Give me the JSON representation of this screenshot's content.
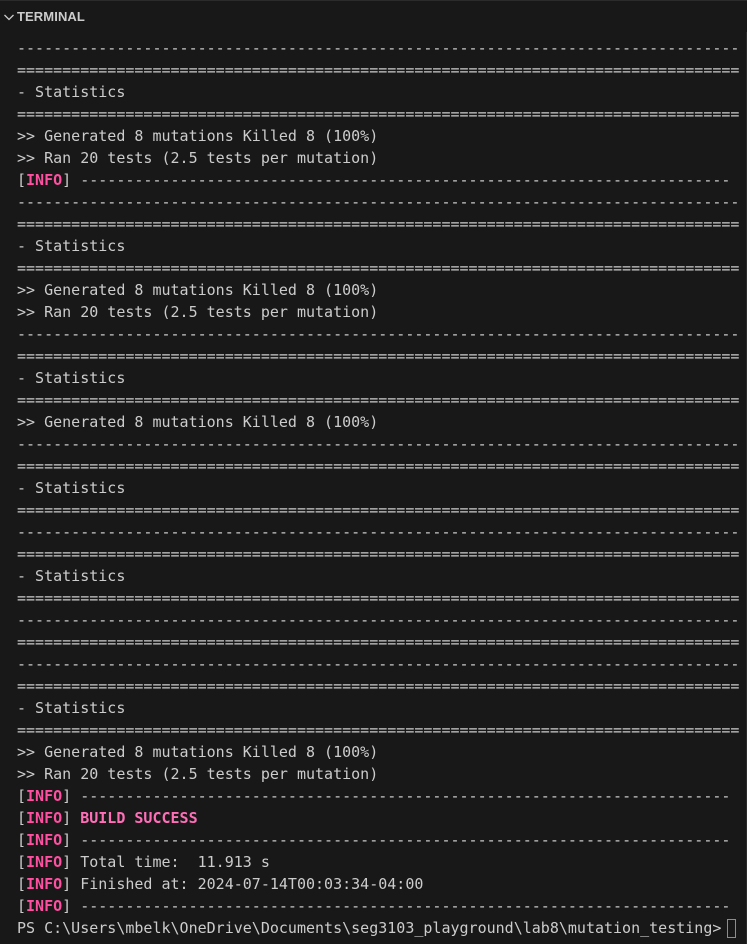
{
  "panel": {
    "title": "TERMINAL",
    "chevron_icon": "chevron-down-icon"
  },
  "colors": {
    "background": "#181818",
    "text": "#cccccc",
    "info": "#ff4fa0",
    "success": "#ff6fb8"
  },
  "terminal": {
    "dash_line": "-----------------------------------------------------------------------------------",
    "equals_line": "===================================================================================",
    "info_dash": "------------------------------------------------------------------------",
    "lines": [
      {
        "kind": "dash"
      },
      {
        "kind": "equals"
      },
      {
        "kind": "text",
        "text": "- Statistics"
      },
      {
        "kind": "equals"
      },
      {
        "kind": "text",
        "text": ">> Generated 8 mutations Killed 8 (100%)"
      },
      {
        "kind": "text",
        "text": ">> Ran 20 tests (2.5 tests per mutation)"
      },
      {
        "kind": "info",
        "text": "------------------------------------------------------------------------"
      },
      {
        "kind": "dash"
      },
      {
        "kind": "equals"
      },
      {
        "kind": "text",
        "text": "- Statistics"
      },
      {
        "kind": "equals"
      },
      {
        "kind": "text",
        "text": ">> Generated 8 mutations Killed 8 (100%)"
      },
      {
        "kind": "text",
        "text": ">> Ran 20 tests (2.5 tests per mutation)"
      },
      {
        "kind": "dash"
      },
      {
        "kind": "equals"
      },
      {
        "kind": "text",
        "text": "- Statistics"
      },
      {
        "kind": "equals"
      },
      {
        "kind": "text",
        "text": ">> Generated 8 mutations Killed 8 (100%)"
      },
      {
        "kind": "dash"
      },
      {
        "kind": "equals"
      },
      {
        "kind": "text",
        "text": "- Statistics"
      },
      {
        "kind": "equals"
      },
      {
        "kind": "dash"
      },
      {
        "kind": "equals"
      },
      {
        "kind": "text",
        "text": "- Statistics"
      },
      {
        "kind": "equals"
      },
      {
        "kind": "dash"
      },
      {
        "kind": "equals"
      },
      {
        "kind": "dash"
      },
      {
        "kind": "equals"
      },
      {
        "kind": "text",
        "text": "- Statistics"
      },
      {
        "kind": "equals"
      },
      {
        "kind": "text",
        "text": ">> Generated 8 mutations Killed 8 (100%)"
      },
      {
        "kind": "text",
        "text": ">> Ran 20 tests (2.5 tests per mutation)"
      },
      {
        "kind": "info",
        "text": "------------------------------------------------------------------------"
      },
      {
        "kind": "info-success",
        "text": "BUILD SUCCESS"
      },
      {
        "kind": "info",
        "text": "------------------------------------------------------------------------"
      },
      {
        "kind": "info",
        "text": "Total time:  11.913 s"
      },
      {
        "kind": "info",
        "text": "Finished at: 2024-07-14T00:03:34-04:00"
      },
      {
        "kind": "info",
        "text": "------------------------------------------------------------------------"
      },
      {
        "kind": "prompt",
        "text": "PS C:\\Users\\mbelk\\OneDrive\\Documents\\seg3103_playground\\lab8\\mutation_testing>"
      }
    ],
    "info_tag": "INFO"
  }
}
